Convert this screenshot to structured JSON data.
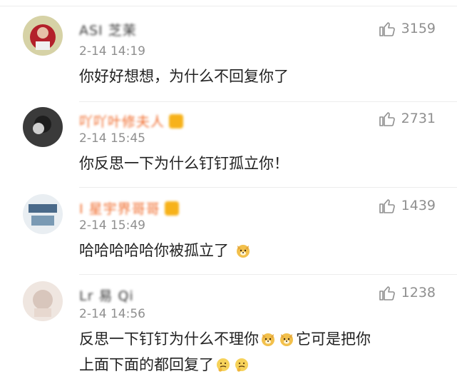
{
  "comments": [
    {
      "username": "ASI 芝茉",
      "timestamp": "2-14 14:19",
      "likes": "3159",
      "content": "你好好想想，为什么不回复你了",
      "colors": {
        "username": "#3a3a3a",
        "avatar": "#b3202a"
      }
    },
    {
      "username": "吖吖叶修夫人",
      "timestamp": "2-14 15:45",
      "likes": "2731",
      "content": "你反思一下为什么钉钉孤立你！",
      "colors": {
        "username": "#f06a2a",
        "avatar": "#2a2a2a"
      }
    },
    {
      "username": "I 星宇界哥哥",
      "timestamp": "2-14 15:49",
      "likes": "1439",
      "content": "哈哈哈哈哈你被孤立了",
      "colors": {
        "username": "#f06a2a",
        "avatar": "#4a6a8a"
      }
    },
    {
      "username": "Lr 易 Qi",
      "timestamp": "2-14 14:56",
      "likes": "1238",
      "content_line1_a": "反思一下钉钉为什么不理你",
      "content_line1_b": "它可是把你",
      "content_line2": "上面下面的都回复了",
      "colors": {
        "username": "#3a3a3a",
        "avatar": "#d8c6bc"
      }
    }
  ],
  "icons": {
    "like": "thumbs-up-icon",
    "doge": "doge-emoji-icon",
    "think": "thinking-emoji-icon"
  }
}
